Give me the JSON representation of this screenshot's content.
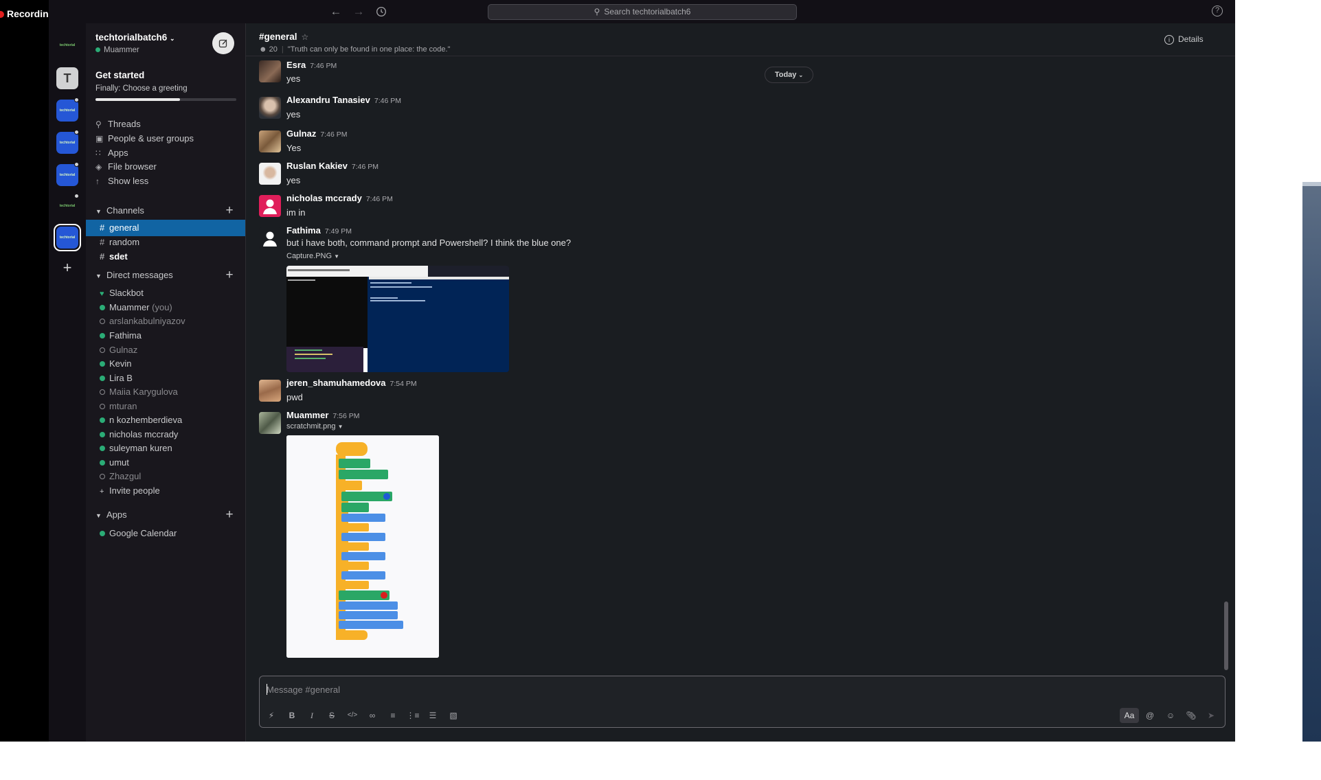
{
  "recording": {
    "label": "Recording"
  },
  "topbar": {
    "search_placeholder": "Search techtorialbatch6",
    "help": "?"
  },
  "rail": {
    "workspaces": [
      "techtorial",
      "T",
      "techtorial",
      "techtorial",
      "techtorial",
      "techtorial",
      "techtorial"
    ],
    "add": "+"
  },
  "workspace": {
    "name": "techtorialbatch6",
    "user": "Muammer"
  },
  "get_started": {
    "title": "Get started",
    "subtitle": "Finally: Choose a greeting",
    "progress": 0.6
  },
  "nav": {
    "threads": "Threads",
    "people": "People & user groups",
    "apps": "Apps",
    "file_browser": "File browser",
    "show_less": "Show less"
  },
  "channels": {
    "header": "Channels",
    "items": [
      "general",
      "random",
      "sdet"
    ]
  },
  "dms": {
    "header": "Direct messages",
    "items": [
      {
        "name": "Slackbot"
      },
      {
        "name": "Muammer",
        "suffix": "(you)"
      },
      {
        "name": "arslankabulniyazov"
      },
      {
        "name": "Fathima"
      },
      {
        "name": "Gulnaz"
      },
      {
        "name": "Kevin"
      },
      {
        "name": "Lira B"
      },
      {
        "name": "Maiia Karygulova"
      },
      {
        "name": "mturan"
      },
      {
        "name": "n kozhemberdieva"
      },
      {
        "name": "nicholas mccrady"
      },
      {
        "name": "suleyman kuren"
      },
      {
        "name": "umut"
      },
      {
        "name": "Zhazgul"
      }
    ],
    "invite": "Invite people"
  },
  "apps_section": {
    "header": "Apps",
    "items": [
      "Google Calendar"
    ]
  },
  "channel": {
    "title": "#general",
    "members": "20",
    "topic": "\"Truth can only be found in one place: the code.\"",
    "details": "Details",
    "date_divider": "Today"
  },
  "messages": [
    {
      "name": "Esra",
      "time": "7:46 PM",
      "text": "yes"
    },
    {
      "name": "Alexandru Tanasiev",
      "time": "7:46 PM",
      "text": "yes"
    },
    {
      "name": "Gulnaz",
      "time": "7:46 PM",
      "text": "Yes"
    },
    {
      "name": "Ruslan Kakiev",
      "time": "7:46 PM",
      "text": "yes"
    },
    {
      "name": "nicholas mccrady",
      "time": "7:46 PM",
      "text": "im in"
    },
    {
      "name": "Fathima",
      "time": "7:49 PM",
      "text": "but i have both, command prompt and Powershell? I think the blue one?",
      "file": "Capture.PNG"
    },
    {
      "name": "jeren_shamuhamedova",
      "time": "7:54 PM",
      "text": "pwd"
    },
    {
      "name": "Muammer",
      "time": "7:56 PM",
      "text": "",
      "file": "scratchmit.png"
    }
  ],
  "composer": {
    "placeholder": "Message #general",
    "format_label": "Aa"
  }
}
